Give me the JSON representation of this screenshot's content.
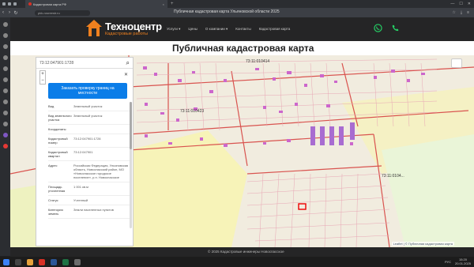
{
  "browser": {
    "tabs": [
      {
        "label": "Кадастровая карта РФ"
      }
    ],
    "url": "pkk-rosreestr.ru",
    "page_title": "Публичная кадастровая карта Ульяновской области 2025"
  },
  "site": {
    "logo_name": "Техноцентр",
    "logo_sub": "Кадастровые работы",
    "menu": [
      "Услуги ▾",
      "Цены",
      "О компании ▾",
      "Контакты",
      "Кадастровая карта"
    ],
    "whatsapp_color": "#25d366",
    "phone_color": "#25d366",
    "accent": "#f0801e"
  },
  "page": {
    "h1": "Публичная кадастровая карта"
  },
  "panel": {
    "search_value": "73:12:047901:1728",
    "order_button": "Заказать проверку границ на местности",
    "rows": [
      {
        "key": "Вид",
        "value": "Земельный участок"
      },
      {
        "key": "Вид земельного участка",
        "value": "Земельный участок"
      },
      {
        "key": "Координаты",
        "value": ""
      },
      {
        "key": "Кадастровый номер",
        "value": "73:12:047901:1728"
      },
      {
        "key": "Кадастровый квартал",
        "value": "73:12:047901"
      },
      {
        "key": "Адрес",
        "value": "Российская Федерация, Ульяновская область, Новоспасский район, МО «Новоспасское городское поселение», р.п. Новоспасское"
      },
      {
        "key": "Площадь уточненная",
        "value": "1 001 кв.м"
      },
      {
        "key": "Статус",
        "value": "Учтенный"
      },
      {
        "key": "Категория земель",
        "value": "Земли населенных пунктов"
      }
    ]
  },
  "map": {
    "labels": [
      "73:11:010414",
      "73:11:010423",
      "73:11:0104..."
    ],
    "attribution": "Leaflet | © Публичная кадастровая карта"
  },
  "footer": {
    "text": "© 2025 Кадастровые инженеры Новоспасское"
  },
  "taskbar": {
    "time": "15:20",
    "date": "20.01.2025",
    "lang": "РУС"
  }
}
